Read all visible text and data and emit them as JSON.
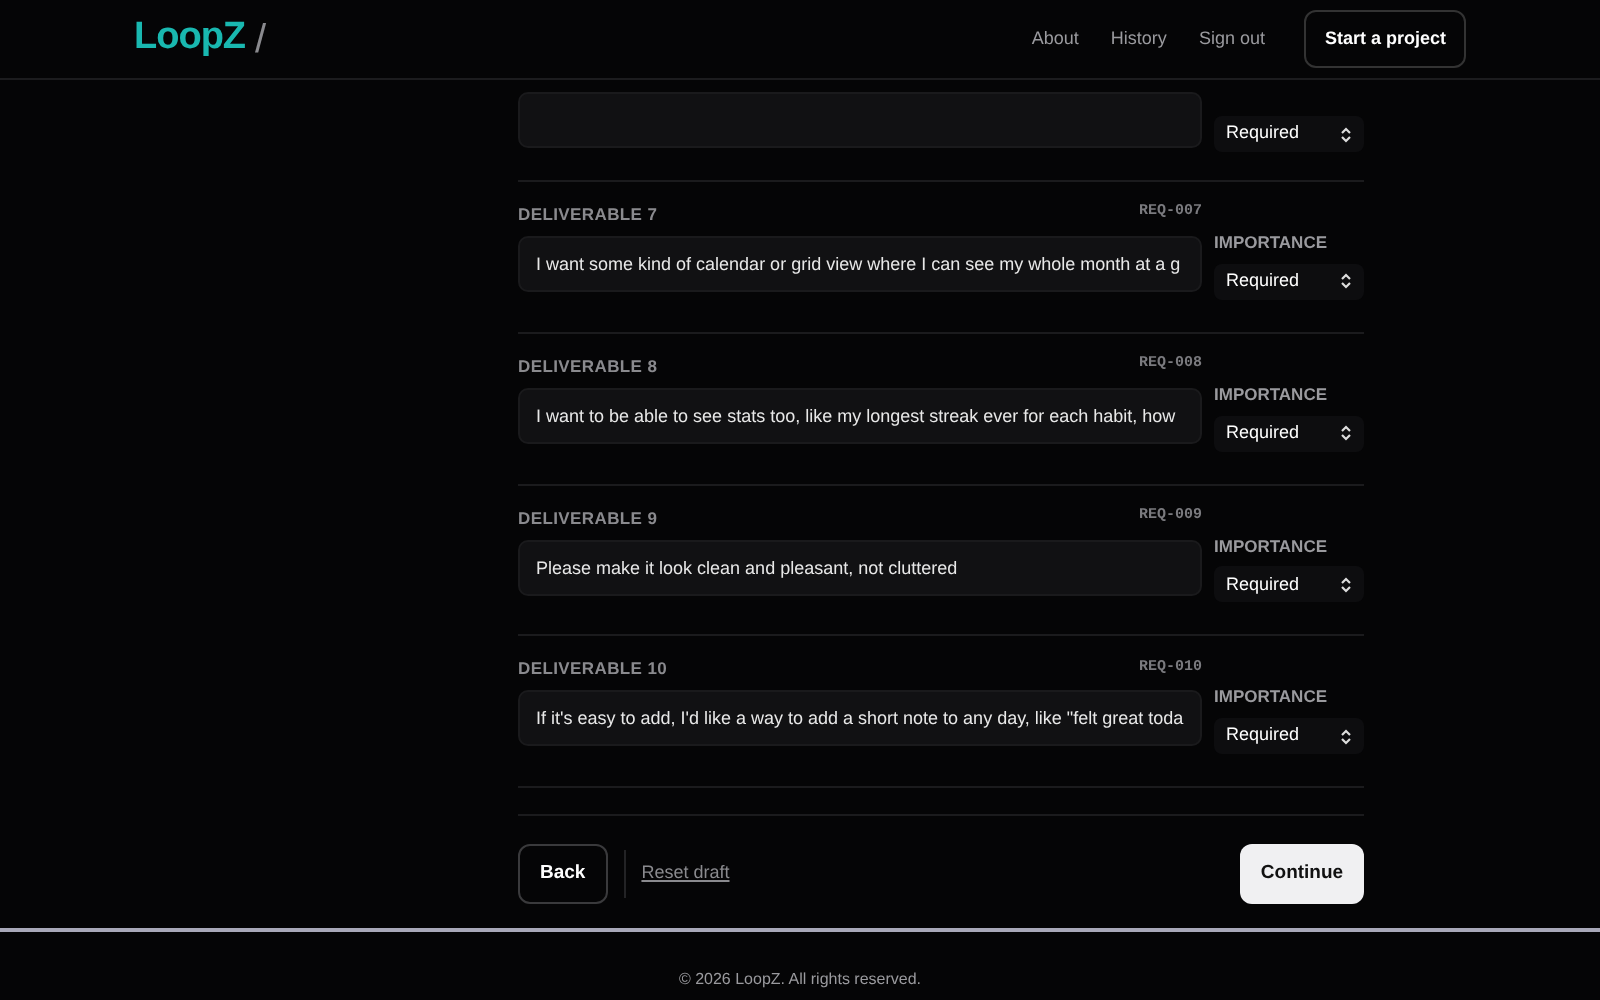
{
  "header": {
    "logo": "LoopZ",
    "logo_slash": "/",
    "nav": [
      "About",
      "History",
      "Sign out"
    ],
    "cta": "Start a project"
  },
  "partial_row": {
    "importance": "Required"
  },
  "deliverables": [
    {
      "label": "DELIVERABLE 7",
      "code": "REQ-007",
      "text": "I want some kind of calendar or grid view where I can see my whole month at a g",
      "importance_label": "IMPORTANCE",
      "importance": "Required"
    },
    {
      "label": "DELIVERABLE 8",
      "code": "REQ-008",
      "text": "I want to be able to see stats too, like my longest streak ever for each habit, how",
      "importance_label": "IMPORTANCE",
      "importance": "Required"
    },
    {
      "label": "DELIVERABLE 9",
      "code": "REQ-009",
      "text": "Please make it look clean and pleasant, not cluttered",
      "importance_label": "IMPORTANCE",
      "importance": "Required"
    },
    {
      "label": "DELIVERABLE 10",
      "code": "REQ-010",
      "text": "If it's easy to add, I'd like a way to add a short note to any day, like \"felt great toda",
      "importance_label": "IMPORTANCE",
      "importance": "Required"
    }
  ],
  "actions": {
    "back": "Back",
    "reset": "Reset draft",
    "continue": "Continue"
  },
  "footer": "© 2026 LoopZ. All rights reserved."
}
